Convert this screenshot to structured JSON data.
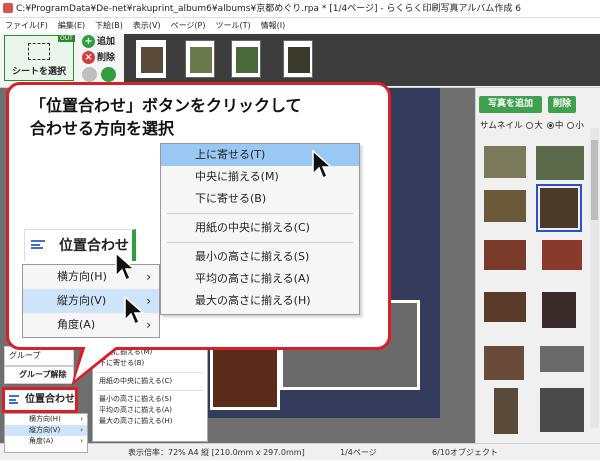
{
  "window": {
    "title": "C:¥ProgramData¥De-net¥rakuprint_album6¥albums¥京都めぐり.rpa * [1/4ページ] - らくらく印刷写真アルバム作成 6"
  },
  "menubar": [
    "ファイル(F)",
    "編集(E)",
    "下絵(B)",
    "表示(V)",
    "ページ(P)",
    "ツール(T)",
    "情報(I)"
  ],
  "toolbar": {
    "sheet_select": "シートを選択",
    "out_tag": "OUT",
    "add": "追加",
    "delete": "削除"
  },
  "right_panel": {
    "add_photo": "写真を追加",
    "delete": "削除",
    "thumbnail_label": "サムネイル",
    "sizes": [
      "大",
      "中",
      "小"
    ],
    "selected_size": "中"
  },
  "status": {
    "scale": "表示倍率：72%",
    "paper": "A4 縦 [210.0mm x 297.0mm]",
    "page": "1/4ページ",
    "objects": "6/10オブジェクト"
  },
  "behind": {
    "bar_label": "グループ",
    "group_release": "グループ解除",
    "position_button": "位置合わせ",
    "menu_items": [
      "中央に揃える(M)",
      "下に寄せる(B)",
      "用紙の中央に揃える(C)",
      "最小の高さに揃える(S)",
      "平均の高さに揃える(A)",
      "最大の高さに揃える(H)"
    ],
    "sub_items": [
      "横方向(H)",
      "縦方向(V)",
      "角度(A)"
    ]
  },
  "callout": {
    "line1": "「位置合わせ」ボタンをクリックして",
    "line2": "合わせる方向を選択",
    "button": "位置合わせ",
    "menu": [
      "横方向(H)",
      "縦方向(V)",
      "角度(A)"
    ],
    "submenu": {
      "top_group": [
        "上に寄せる(T)",
        "中央に揃える(M)",
        "下に寄せる(B)"
      ],
      "mid_group": [
        "用紙の中央に揃える(C)"
      ],
      "bottom_group": [
        "最小の高さに揃える(S)",
        "平均の高さに揃える(A)",
        "最大の高さに揃える(H)"
      ]
    }
  },
  "colors": {
    "accent_green": "#2e9e3e",
    "callout_red": "#d81f2a",
    "highlight_blue": "#99c8f4"
  }
}
